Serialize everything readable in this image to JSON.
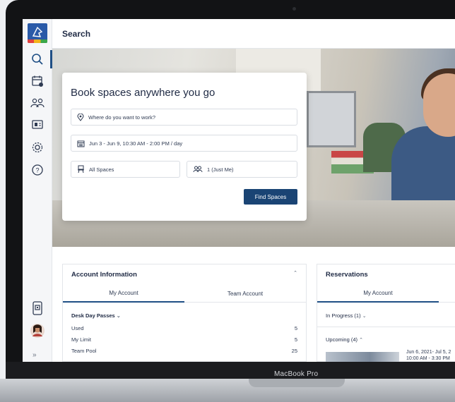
{
  "device": {
    "label": "MacBook Pro"
  },
  "header": {
    "title": "Search"
  },
  "booking": {
    "title": "Book spaces anywhere you go",
    "location_placeholder": "Where do you want to work?",
    "dates": "Jun 3 - Jun 9, 10:30 AM - 2:00 PM / day",
    "space_type": "All Spaces",
    "attendees": "1 (Just Me)",
    "find_button": "Find Spaces"
  },
  "account": {
    "title": "Account Information",
    "tabs": [
      "My Account",
      "Team Account"
    ],
    "section": "Desk Day Passes",
    "rows": [
      {
        "label": "Used",
        "value": "5"
      },
      {
        "label": "My Limit",
        "value": "5"
      },
      {
        "label": "Team Pool",
        "value": "25"
      }
    ]
  },
  "reservations": {
    "title": "Reservations",
    "tab": "My Account",
    "in_progress": "In Progress (1)",
    "upcoming": "Upcoming (4)",
    "item_date": "Jun 6, 2021- Jul 5, 2",
    "item_time": "10:00 AM - 3:30 PM"
  },
  "colors": {
    "primary": "#1a4474",
    "accent": "#1f4f85",
    "text": "#1f2a44"
  },
  "icons": [
    "search-icon",
    "calendar-check-icon",
    "people-icon",
    "spaces-icon",
    "settings-gear-icon",
    "help-icon",
    "qr-checkin-icon",
    "user-avatar",
    "expand-sidebar-icon"
  ]
}
